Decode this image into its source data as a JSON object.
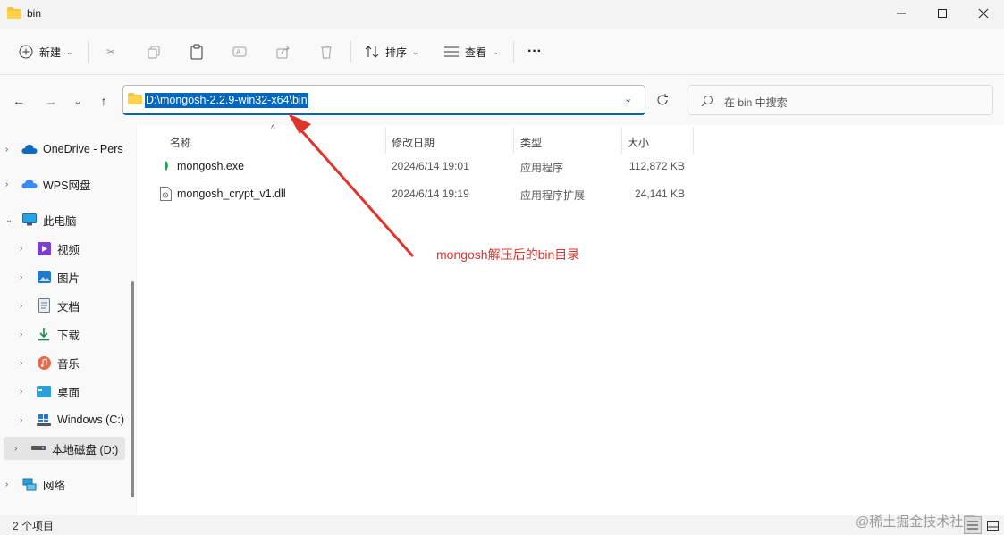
{
  "window": {
    "title": "bin"
  },
  "toolbar": {
    "new_label": "新建",
    "sort_label": "排序",
    "view_label": "查看",
    "more_label": "···"
  },
  "address": {
    "path": "D:\\mongosh-2.2.9-win32-x64\\bin",
    "search_placeholder": "在 bin 中搜索"
  },
  "sidebar": {
    "items": [
      {
        "label": "OneDrive - Pers",
        "icon": "cloud-icon"
      },
      {
        "label": "WPS网盘",
        "icon": "wps-cloud-icon"
      },
      {
        "label": "此电脑",
        "icon": "computer-icon"
      },
      {
        "label": "视频",
        "icon": "video-icon"
      },
      {
        "label": "图片",
        "icon": "pictures-icon"
      },
      {
        "label": "文档",
        "icon": "documents-icon"
      },
      {
        "label": "下载",
        "icon": "download-icon"
      },
      {
        "label": "音乐",
        "icon": "music-icon"
      },
      {
        "label": "桌面",
        "icon": "desktop-icon"
      },
      {
        "label": "Windows (C:)",
        "icon": "windows-drive-icon"
      },
      {
        "label": "本地磁盘 (D:)",
        "icon": "drive-icon"
      },
      {
        "label": "网络",
        "icon": "network-icon"
      }
    ]
  },
  "columns": {
    "name": "名称",
    "modified": "修改日期",
    "type": "类型",
    "size": "大小"
  },
  "files": [
    {
      "name": "mongosh.exe",
      "modified": "2024/6/14 19:01",
      "type": "应用程序",
      "size": "112,872 KB"
    },
    {
      "name": "mongosh_crypt_v1.dll",
      "modified": "2024/6/14 19:19",
      "type": "应用程序扩展",
      "size": "24,141 KB"
    }
  ],
  "annotation": "mongosh解压后的bin目录",
  "status": {
    "item_count": "2 个项目"
  },
  "watermark": "@稀土掘金技术社区",
  "colors": {
    "accent": "#0067c0",
    "annotation": "#e0342b"
  }
}
